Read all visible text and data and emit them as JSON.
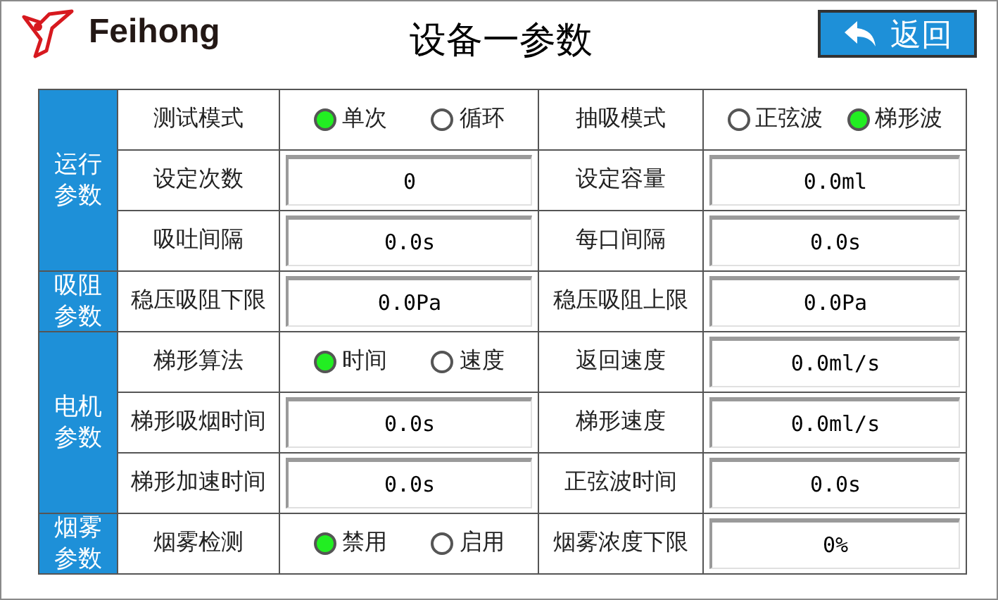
{
  "header": {
    "logo_text": "Feihong",
    "title": "设备一参数",
    "back_button": "返回"
  },
  "groups": [
    {
      "title": "运行参数",
      "rows": [
        [
          {
            "kind": "label",
            "text": "测试模式"
          },
          {
            "kind": "radio",
            "options": [
              {
                "label": "单次",
                "selected": true
              },
              {
                "label": "循环",
                "selected": false
              }
            ]
          },
          {
            "kind": "label",
            "text": "抽吸模式"
          },
          {
            "kind": "radio",
            "options": [
              {
                "label": "正弦波",
                "selected": false
              },
              {
                "label": "梯形波",
                "selected": true
              }
            ]
          }
        ],
        [
          {
            "kind": "label",
            "text": "设定次数"
          },
          {
            "kind": "field",
            "value": "0"
          },
          {
            "kind": "label",
            "text": "设定容量"
          },
          {
            "kind": "field",
            "value": "0.0ml"
          }
        ],
        [
          {
            "kind": "label",
            "text": "吸吐间隔"
          },
          {
            "kind": "field",
            "value": "0.0s"
          },
          {
            "kind": "label",
            "text": "每口间隔"
          },
          {
            "kind": "field",
            "value": "0.0s"
          }
        ]
      ]
    },
    {
      "title": "吸阻参数",
      "rows": [
        [
          {
            "kind": "label",
            "text": "稳压吸阻下限"
          },
          {
            "kind": "field",
            "value": "0.0Pa"
          },
          {
            "kind": "label",
            "text": "稳压吸阻上限"
          },
          {
            "kind": "field",
            "value": "0.0Pa"
          }
        ]
      ]
    },
    {
      "title": "电机参数",
      "rows": [
        [
          {
            "kind": "label",
            "text": "梯形算法"
          },
          {
            "kind": "radio",
            "options": [
              {
                "label": "时间",
                "selected": true
              },
              {
                "label": "速度",
                "selected": false
              }
            ]
          },
          {
            "kind": "label",
            "text": "返回速度"
          },
          {
            "kind": "field",
            "value": "0.0ml/s"
          }
        ],
        [
          {
            "kind": "label",
            "text": "梯形吸烟时间"
          },
          {
            "kind": "field",
            "value": "0.0s"
          },
          {
            "kind": "label",
            "text": "梯形速度"
          },
          {
            "kind": "field",
            "value": "0.0ml/s"
          }
        ],
        [
          {
            "kind": "label",
            "text": "梯形加速时间"
          },
          {
            "kind": "field",
            "value": "0.0s"
          },
          {
            "kind": "label",
            "text": "正弦波时间"
          },
          {
            "kind": "field",
            "value": "0.0s"
          }
        ]
      ]
    },
    {
      "title": "烟雾参数",
      "rows": [
        [
          {
            "kind": "label",
            "text": "烟雾检测"
          },
          {
            "kind": "radio",
            "options": [
              {
                "label": "禁用",
                "selected": true
              },
              {
                "label": "启用",
                "selected": false
              }
            ]
          },
          {
            "kind": "label",
            "text": "烟雾浓度下限"
          },
          {
            "kind": "field",
            "value": "0%"
          }
        ]
      ]
    }
  ]
}
